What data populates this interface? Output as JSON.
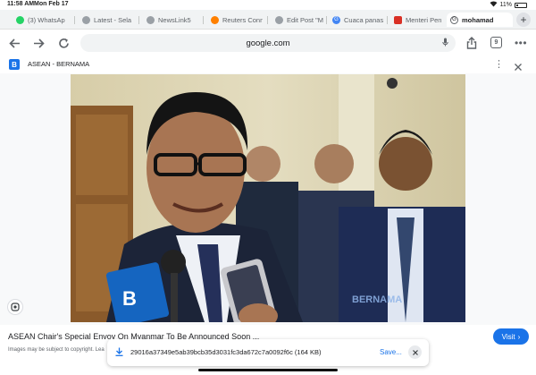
{
  "status": {
    "time": "11:58 AM",
    "date": "Mon Feb 17",
    "battery": "11%"
  },
  "tabs": [
    {
      "label": "(3) WhatsAp",
      "icon": "whatsapp-icon",
      "color": "#25d366"
    },
    {
      "label": "Latest - Sela",
      "icon": "globe-icon",
      "color": "#9aa0a6"
    },
    {
      "label": "NewsLink5",
      "icon": "globe-icon",
      "color": "#9aa0a6"
    },
    {
      "label": "Reuters Conn",
      "icon": "reuters-icon",
      "color": "#ff8000"
    },
    {
      "label": "Edit Post \"M",
      "icon": "wordpress-icon",
      "color": "#9aa0a6"
    },
    {
      "label": "Cuaca panas",
      "icon": "google-icon",
      "color": "#4285f4"
    },
    {
      "label": "Menteri Pen",
      "icon": "news-icon",
      "color": "#d93025"
    },
    {
      "label": "mohamad",
      "icon": "google-icon",
      "color": "#202124"
    }
  ],
  "toolbar": {
    "url": "google.com",
    "tab_count": "9"
  },
  "source": {
    "name": "ASEAN - BERNAMA",
    "logo_letter": "B"
  },
  "image": {
    "watermark": "BERNAMA",
    "mic_label": "BERNAMA"
  },
  "caption": {
    "title": "ASEAN Chair's Special Envoy On Myanmar To Be Announced Soon ...",
    "copyright": "Images may be subject to copyright. Lea",
    "visit_label": "Visit"
  },
  "download": {
    "filename": "29016a37349e5ab39bcb35d3031fc3da672c7a0092f6c (164 KB)",
    "save_label": "Save..."
  },
  "colors": {
    "accent": "#1a73e8",
    "bernama_blue": "#1a73e8"
  }
}
